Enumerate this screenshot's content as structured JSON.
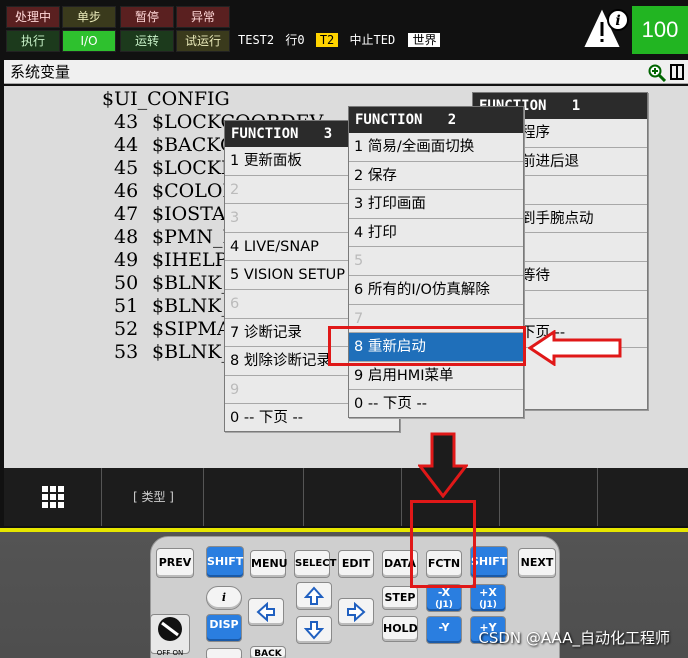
{
  "status": {
    "row1": [
      "处理中",
      "单步",
      "暂停",
      "异常"
    ],
    "row2": [
      "执行",
      "I/O",
      "运转",
      "试运行"
    ],
    "line": {
      "program": "TEST2",
      "row": "行0",
      "mode": "T2",
      "state": "中止TED",
      "frame": "世界"
    },
    "override": "100"
  },
  "title": "系统变量",
  "code_lines": [
    {
      "num": "",
      "text": "$UI_CONFIG"
    },
    {
      "num": "43",
      "text": "$LOCKCOORDEV"
    },
    {
      "num": "44",
      "text": "$BACKO"
    },
    {
      "num": "45",
      "text": "$LOCKB"
    },
    {
      "num": "46",
      "text": "$COLOR"
    },
    {
      "num": "47",
      "text": "$IOSTA"
    },
    {
      "num": "48",
      "text": "$PMN_M"
    },
    {
      "num": "49",
      "text": "$IHELP"
    },
    {
      "num": "50",
      "text": "$BLNK_"
    },
    {
      "num": "51",
      "text": "$BLNK_"
    },
    {
      "num": "52",
      "text": "$SIPMA"
    },
    {
      "num": "53",
      "text": "$BLNK_"
    }
  ],
  "func1": {
    "title": "FUNCTION   1",
    "items": [
      "程序",
      "前进后退",
      "",
      "到手腕点动",
      "",
      "等待",
      "",
      "下页  --"
    ]
  },
  "func3": {
    "title": "FUNCTION   3",
    "items": [
      "1 更新面板",
      "2",
      "3",
      "4 LIVE/SNAP",
      "5 VISION SETUP",
      "6",
      "7 诊断记录",
      "8 划除诊断记录",
      "9",
      "0 -- 下页 --"
    ]
  },
  "func2": {
    "title": "FUNCTION   2",
    "items": [
      "1 简易/全画面切换",
      "2 保存",
      "3 打印画面",
      "4 打印",
      "5",
      "6 所有的I/O仿真解除",
      "7",
      "8 重新启动",
      "9 启用HMI菜单",
      "0 -- 下页 --"
    ]
  },
  "softkeys": {
    "type": "[ 类型 ]"
  },
  "pendant": {
    "prev": "PREV",
    "shift": "SHIFT",
    "menu": "MENU",
    "select": "SELECT",
    "edit": "EDIT",
    "data": "DATA",
    "fctn": "FCTN",
    "next": "NEXT",
    "info": "i",
    "disp": "DISP",
    "step": "STEP",
    "hold": "HOLD",
    "back": "BACK",
    "minus_x": "-X",
    "j1a": "(J1)",
    "plus_x": "+X",
    "j1b": "(J1)",
    "minus_y": "-Y",
    "plus_y": "+Y",
    "off_on": "OFF ON"
  },
  "watermark": "CSDN @AAA_自动化工程师",
  "colors": {
    "selected": "#1f6fba",
    "highlight": "#e01818",
    "on": "#2ec12e"
  }
}
